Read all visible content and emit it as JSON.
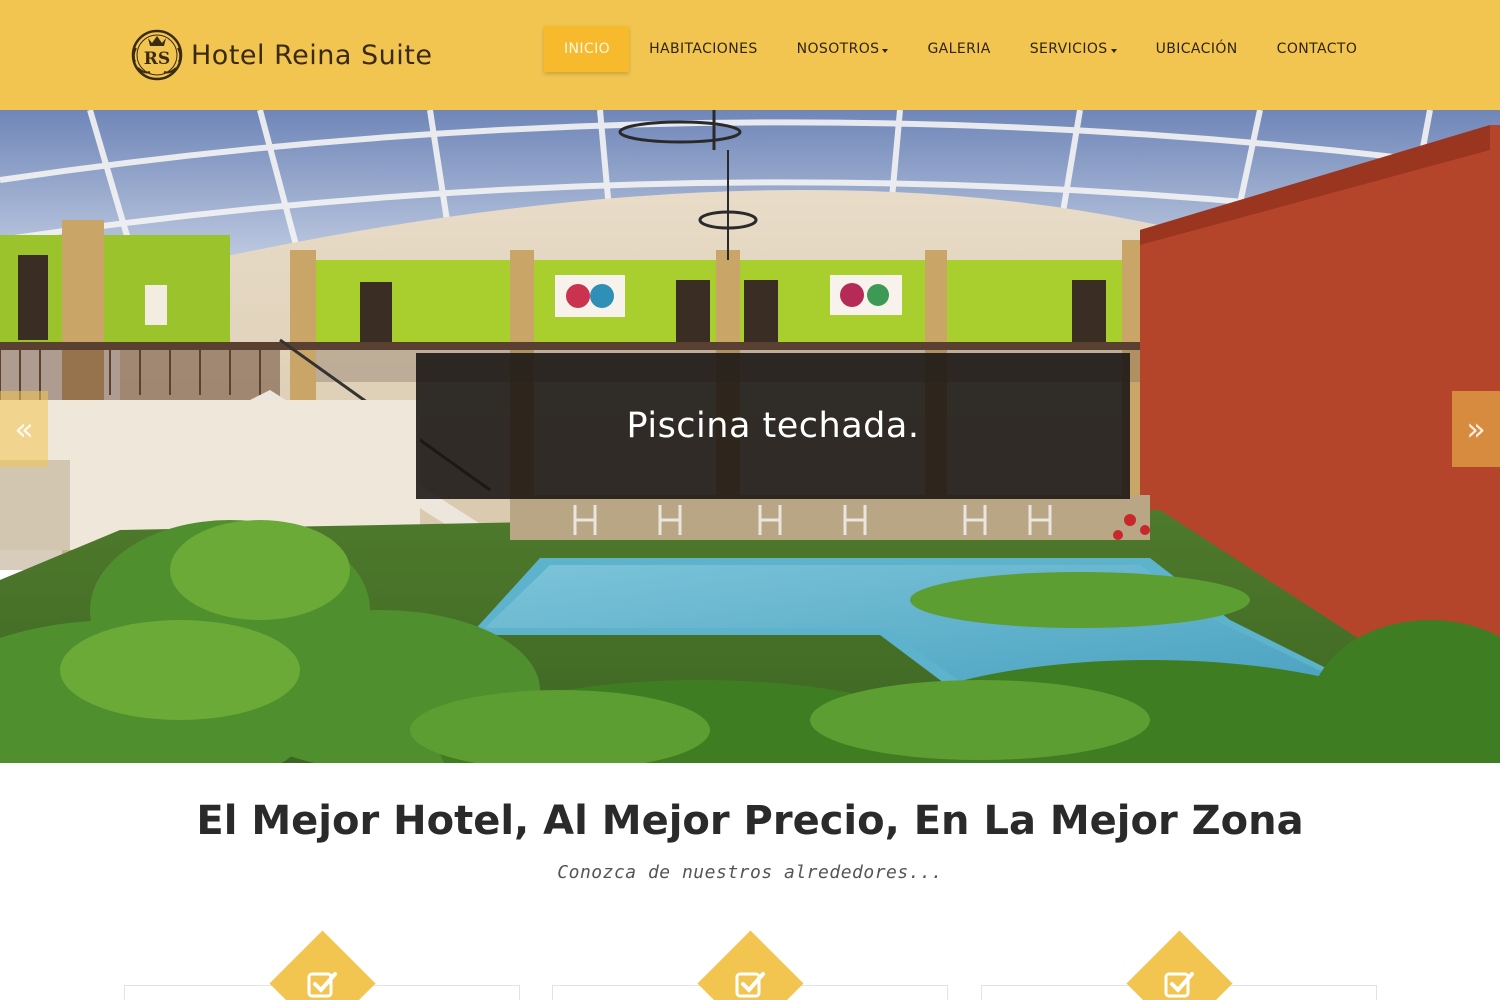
{
  "brand": {
    "name": "Hotel Reina Suite",
    "monogram": "RS",
    "logo_icon": "crown-monogram-icon"
  },
  "colors": {
    "header_bg": "#f2c551",
    "active_nav": "#f7ba2c",
    "accent": "#f2c551"
  },
  "nav": {
    "items": [
      {
        "label": "INICIO",
        "active": true,
        "dropdown": false
      },
      {
        "label": "HABITACIONES",
        "active": false,
        "dropdown": false
      },
      {
        "label": "NOSOTROS",
        "active": false,
        "dropdown": true
      },
      {
        "label": "GALERIA",
        "active": false,
        "dropdown": false
      },
      {
        "label": "SERVICIOS",
        "active": false,
        "dropdown": true
      },
      {
        "label": "UBICACIÓN",
        "active": false,
        "dropdown": false
      },
      {
        "label": "CONTACTO",
        "active": false,
        "dropdown": false
      }
    ]
  },
  "hero": {
    "caption": "Piscina techada.",
    "prev_icon": "double-chevron-left-icon",
    "next_icon": "double-chevron-right-icon",
    "prev_glyph": "«",
    "next_glyph": "»"
  },
  "intro": {
    "headline": "El Mejor Hotel, Al Mejor Precio, En La Mejor Zona",
    "subheadline": "Conozca de nuestros alrededores..."
  },
  "features": [
    {
      "icon": "check-square-icon"
    },
    {
      "icon": "check-square-icon"
    },
    {
      "icon": "check-square-icon"
    }
  ]
}
